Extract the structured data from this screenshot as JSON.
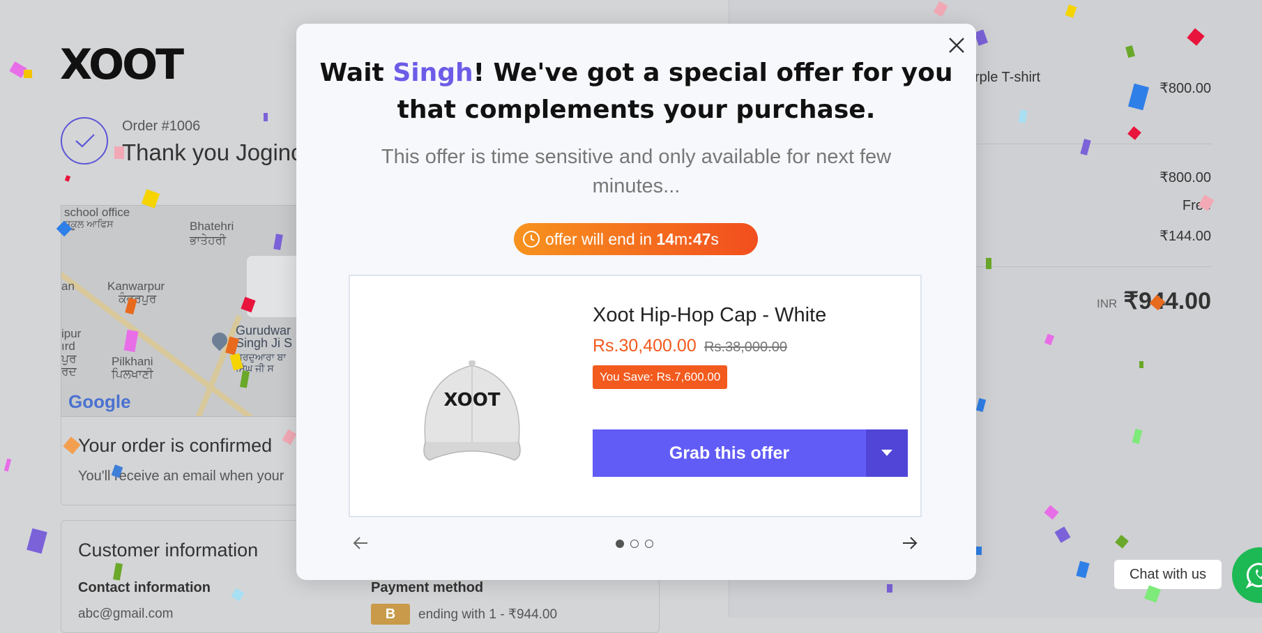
{
  "page": {
    "logo": "XOOT",
    "order_number": "Order #1006",
    "thank_you": "Thank you Joginc",
    "map_labels": [
      "school office",
      "ਸਕੂਲ ਆਫਿਸ",
      "Bhatehri",
      "ਭਾਤੇਹਰੀ",
      "Kanwarpur",
      "ਕੰਵਰਪੁਰ",
      "Pilkhani",
      "ਪਿਲਖਾਣੀ",
      "Gurudwar",
      "Singh Ji S",
      "ਗੁਰਦੁਆਰਾ ਬਾ",
      "ਸਿੰਘ ਜੀ ਸ",
      "an",
      "ipur",
      "ırd",
      "ਪੁਰ",
      "ਰਦ"
    ],
    "map_brand": "Google",
    "confirmed_title": "Your order is confirmed",
    "confirmed_sub": "You'll receive an email when your",
    "customer_info_title": "Customer information",
    "contact_info_title": "Contact information",
    "contact_email": "abc@gmail.com",
    "payment_method_title": "Payment method",
    "payment_badge": "B",
    "payment_detail": "ending with 1 - ₹944.00"
  },
  "summary": {
    "item_name": "rple T-shirt",
    "item_price": "₹800.00",
    "subtotal": "₹800.00",
    "shipping": "Free",
    "taxes": "₹144.00",
    "currency": "INR",
    "total": "₹944.00"
  },
  "chat": {
    "label": "Chat with us"
  },
  "modal": {
    "title_before": "Wait ",
    "title_name": "Singh",
    "title_after": "! We've got a special offer for you that complements your purchase.",
    "subtitle": "This offer is time sensitive and only available for next few minutes...",
    "timer_prefix": "offer will end in ",
    "timer_minutes": "14",
    "timer_m": "m",
    "timer_sep": ":",
    "timer_seconds": "47",
    "timer_s": "s",
    "product": {
      "image_text": "XOOT",
      "name": "Xoot Hip-Hop Cap - White",
      "price": "Rs.30,400.00",
      "old_price": "Rs.38,000.00",
      "save": "You Save: Rs.7,600.00",
      "cta": "Grab this offer"
    },
    "carousel": {
      "active_index": 0,
      "total": 3
    }
  },
  "colors": {
    "accent": "#615cf6",
    "accent_dark": "#5145d8",
    "name_highlight": "#6c5ce7",
    "price": "#f25a1e",
    "timer_start": "#f7931e",
    "timer_end": "#f24e1e",
    "whatsapp": "#1db954"
  },
  "icons": [
    "close-icon",
    "clock-icon",
    "chevron-down-icon",
    "arrow-left-icon",
    "arrow-right-icon",
    "checkmark-icon",
    "whatsapp-icon",
    "map-pin-icon"
  ]
}
